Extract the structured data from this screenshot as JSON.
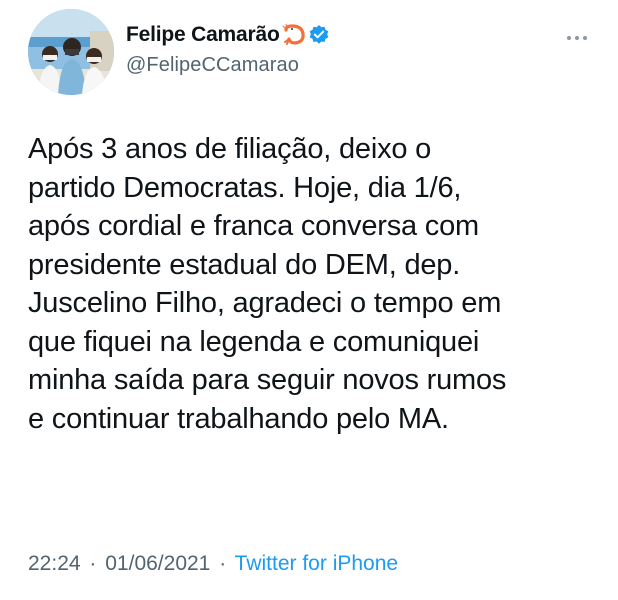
{
  "author": {
    "display_name": "Felipe Camarão",
    "handle": "@FelipeCCamarao",
    "verified": true,
    "name_emoji": "shrimp-icon",
    "verified_color": "#1d9bf0"
  },
  "tweet": {
    "lines": [
      "Após 3 anos de filiação, deixo o",
      "partido Democratas. Hoje, dia 1/6,",
      "após cordial e franca conversa com",
      "presidente estadual do DEM, dep.",
      "Juscelino Filho, agradeci o tempo em",
      "que fiquei na legenda e comuniquei",
      "minha saída para seguir novos rumos",
      "e continuar trabalhando pelo MA."
    ]
  },
  "meta": {
    "time": "22:24",
    "separator": "·",
    "date": "01/06/2021",
    "source": "Twitter for iPhone"
  },
  "colors": {
    "text": "#0f1419",
    "secondary": "#536471",
    "link": "#1d9bf0"
  }
}
